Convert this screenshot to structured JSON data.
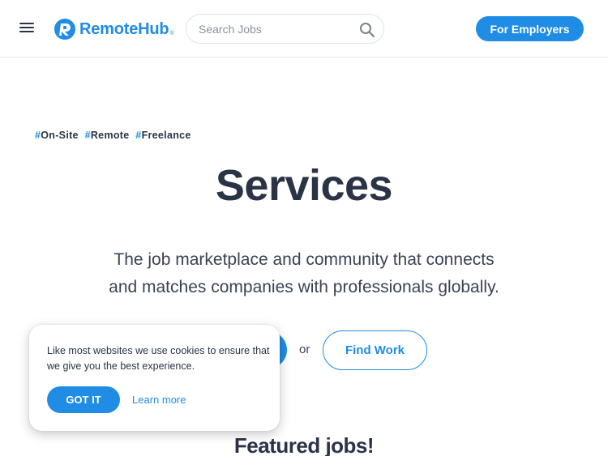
{
  "header": {
    "brand_name": "RemoteHub",
    "brand_reg": "®",
    "search": {
      "placeholder": "Search Jobs",
      "value": ""
    },
    "employers_label": "For Employers"
  },
  "hero": {
    "tags": [
      {
        "hash": "#",
        "label": "On-Site"
      },
      {
        "hash": "#",
        "label": "Remote"
      },
      {
        "hash": "#",
        "label": "Freelance"
      }
    ],
    "title": "Services",
    "subtitle_line1": "The job marketplace and community that connects",
    "subtitle_line2": "and matches companies with professionals globally.",
    "or_label": "or",
    "find_work_label": "Find Work",
    "featured_title": "Featured jobs!"
  },
  "cookie": {
    "message": "Like most websites we use cookies to ensure that we give you the best experience.",
    "accept_label": "GOT IT",
    "learn_more_label": "Learn more"
  },
  "colors": {
    "accent": "#1f8ce6",
    "text": "#2b3347"
  },
  "icons": {
    "menu": "hamburger-menu-icon",
    "logo": "remotehub-logo-icon",
    "search": "search-icon"
  }
}
